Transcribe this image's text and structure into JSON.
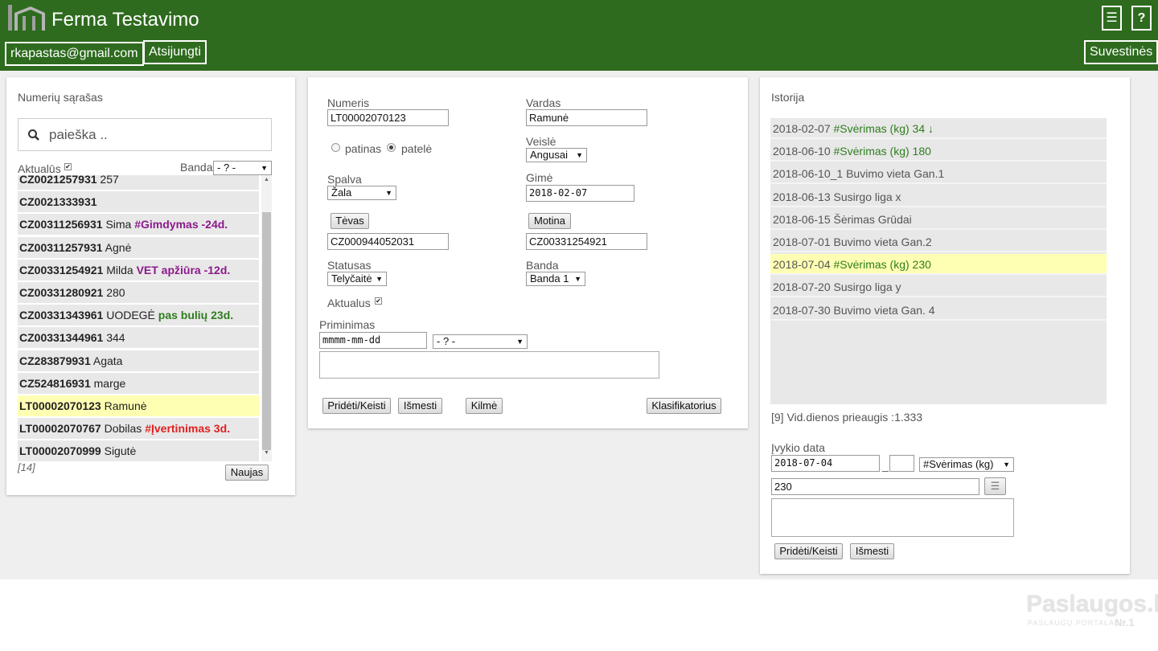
{
  "header": {
    "title": "Ferma Testavimo",
    "menu_icon": "☰",
    "help_label": "?",
    "email": "rkapastas@gmail.com",
    "logout": "Atsijungti",
    "summary": "Suvestinės",
    "color": "#2e6b1e"
  },
  "left": {
    "title": "Numerių sąrašas",
    "search_placeholder": "paieška ..",
    "actual_label": "Aktualūs",
    "herd_label": "Banda",
    "herd_value": "- ? -",
    "rows": [
      {
        "id": "CZ0021257931",
        "name": "257",
        "note": "",
        "note_color": ""
      },
      {
        "id": "CZ0021333931",
        "name": "",
        "note": "",
        "note_color": ""
      },
      {
        "id": "CZ00311256931",
        "name": "Sima",
        "note": "#Gimdymas -24d.",
        "note_color": "#8b1a8b"
      },
      {
        "id": "CZ00311257931",
        "name": "Agnė",
        "note": "",
        "note_color": ""
      },
      {
        "id": "CZ00331254921",
        "name": "Milda",
        "note": "VET apžiūra -12d.",
        "note_color": "#8b1a8b"
      },
      {
        "id": "CZ00331280921",
        "name": "280",
        "note": "",
        "note_color": ""
      },
      {
        "id": "CZ00331343961",
        "name": "UODEGĖ",
        "note": "pas bulių 23d.",
        "note_color": "#2e7d1e"
      },
      {
        "id": "CZ00331344961",
        "name": "344",
        "note": "",
        "note_color": ""
      },
      {
        "id": "CZ283879931",
        "name": "Agata",
        "note": "",
        "note_color": ""
      },
      {
        "id": "CZ524816931",
        "name": "marge",
        "note": "",
        "note_color": ""
      },
      {
        "id": "LT00002070123",
        "name": "Ramunė",
        "note": "",
        "note_color": "",
        "selected": true
      },
      {
        "id": "LT00002070767",
        "name": "Dobilas",
        "note": "#Įvertinimas 3d.",
        "note_color": "#e02020"
      },
      {
        "id": "LT00002070999",
        "name": "Sigutė",
        "note": "",
        "note_color": ""
      }
    ],
    "count": "[14]",
    "new_button": "Naujas"
  },
  "middle": {
    "number_label": "Numeris",
    "number_value": "LT00002070123",
    "name_label": "Vardas",
    "name_value": "Ramunė",
    "male_label": "patinas",
    "female_label": "patelė",
    "breed_label": "Veislė",
    "breed_value": "Angusai",
    "color_label": "Spalva",
    "color_value": "Žala",
    "born_label": "Gimė",
    "born_value": "2018-02-07",
    "father_button": "Tėvas",
    "father_value": "CZ000944052031",
    "mother_button": "Motina",
    "mother_value": "CZ00331254921",
    "status_label": "Statusas",
    "status_value": "Telyčaitė",
    "herd_label": "Banda",
    "herd_value": "Banda 1",
    "actual_label": "Aktualus",
    "reminder_label": "Priminimas",
    "reminder_date": "mmmm-mm-dd",
    "reminder_select": "- ? -",
    "add_button": "Pridėti/Keisti",
    "delete_button": "Išmesti",
    "origin_button": "Kilmė",
    "classifier_button": "Klasifikatorius"
  },
  "right": {
    "title": "Istorija",
    "history": [
      {
        "date": "2018-02-07",
        "event": "#Svėrimas (kg) 34 ↓",
        "green": true
      },
      {
        "date": "2018-06-10",
        "event": "#Svėrimas (kg) 180",
        "green": true
      },
      {
        "date": "2018-06-10_1",
        "event": "Buvimo vieta Gan.1",
        "green": false
      },
      {
        "date": "2018-06-13",
        "event": "Susirgo liga x",
        "green": false
      },
      {
        "date": "2018-06-15",
        "event": "Šėrimas Grūdai",
        "green": false
      },
      {
        "date": "2018-07-01",
        "event": "Buvimo vieta Gan.2",
        "green": false
      },
      {
        "date": "2018-07-04",
        "event": "#Svėrimas (kg) 230",
        "green": true,
        "selected": true
      },
      {
        "date": "2018-07-20",
        "event": "Susirgo liga y",
        "green": false
      },
      {
        "date": "2018-07-30",
        "event": "Buvimo vieta Gan. 4",
        "green": false
      }
    ],
    "daily_gain": "[9] Vid.dienos prieaugis :1.333",
    "event_date_label": "Įvykio data",
    "event_date_value": "2018-07-04",
    "event_sep": "_",
    "event_type_value": "#Svėrimas (kg)",
    "event_value": "230",
    "list_icon": "☰",
    "add_button": "Pridėti/Keisti",
    "delete_button": "Išmesti"
  },
  "watermark": {
    "brand": "Paslaugos.lt",
    "sub": "PASLAUGŲ PORTALAS",
    "nr": "Nr.1"
  }
}
